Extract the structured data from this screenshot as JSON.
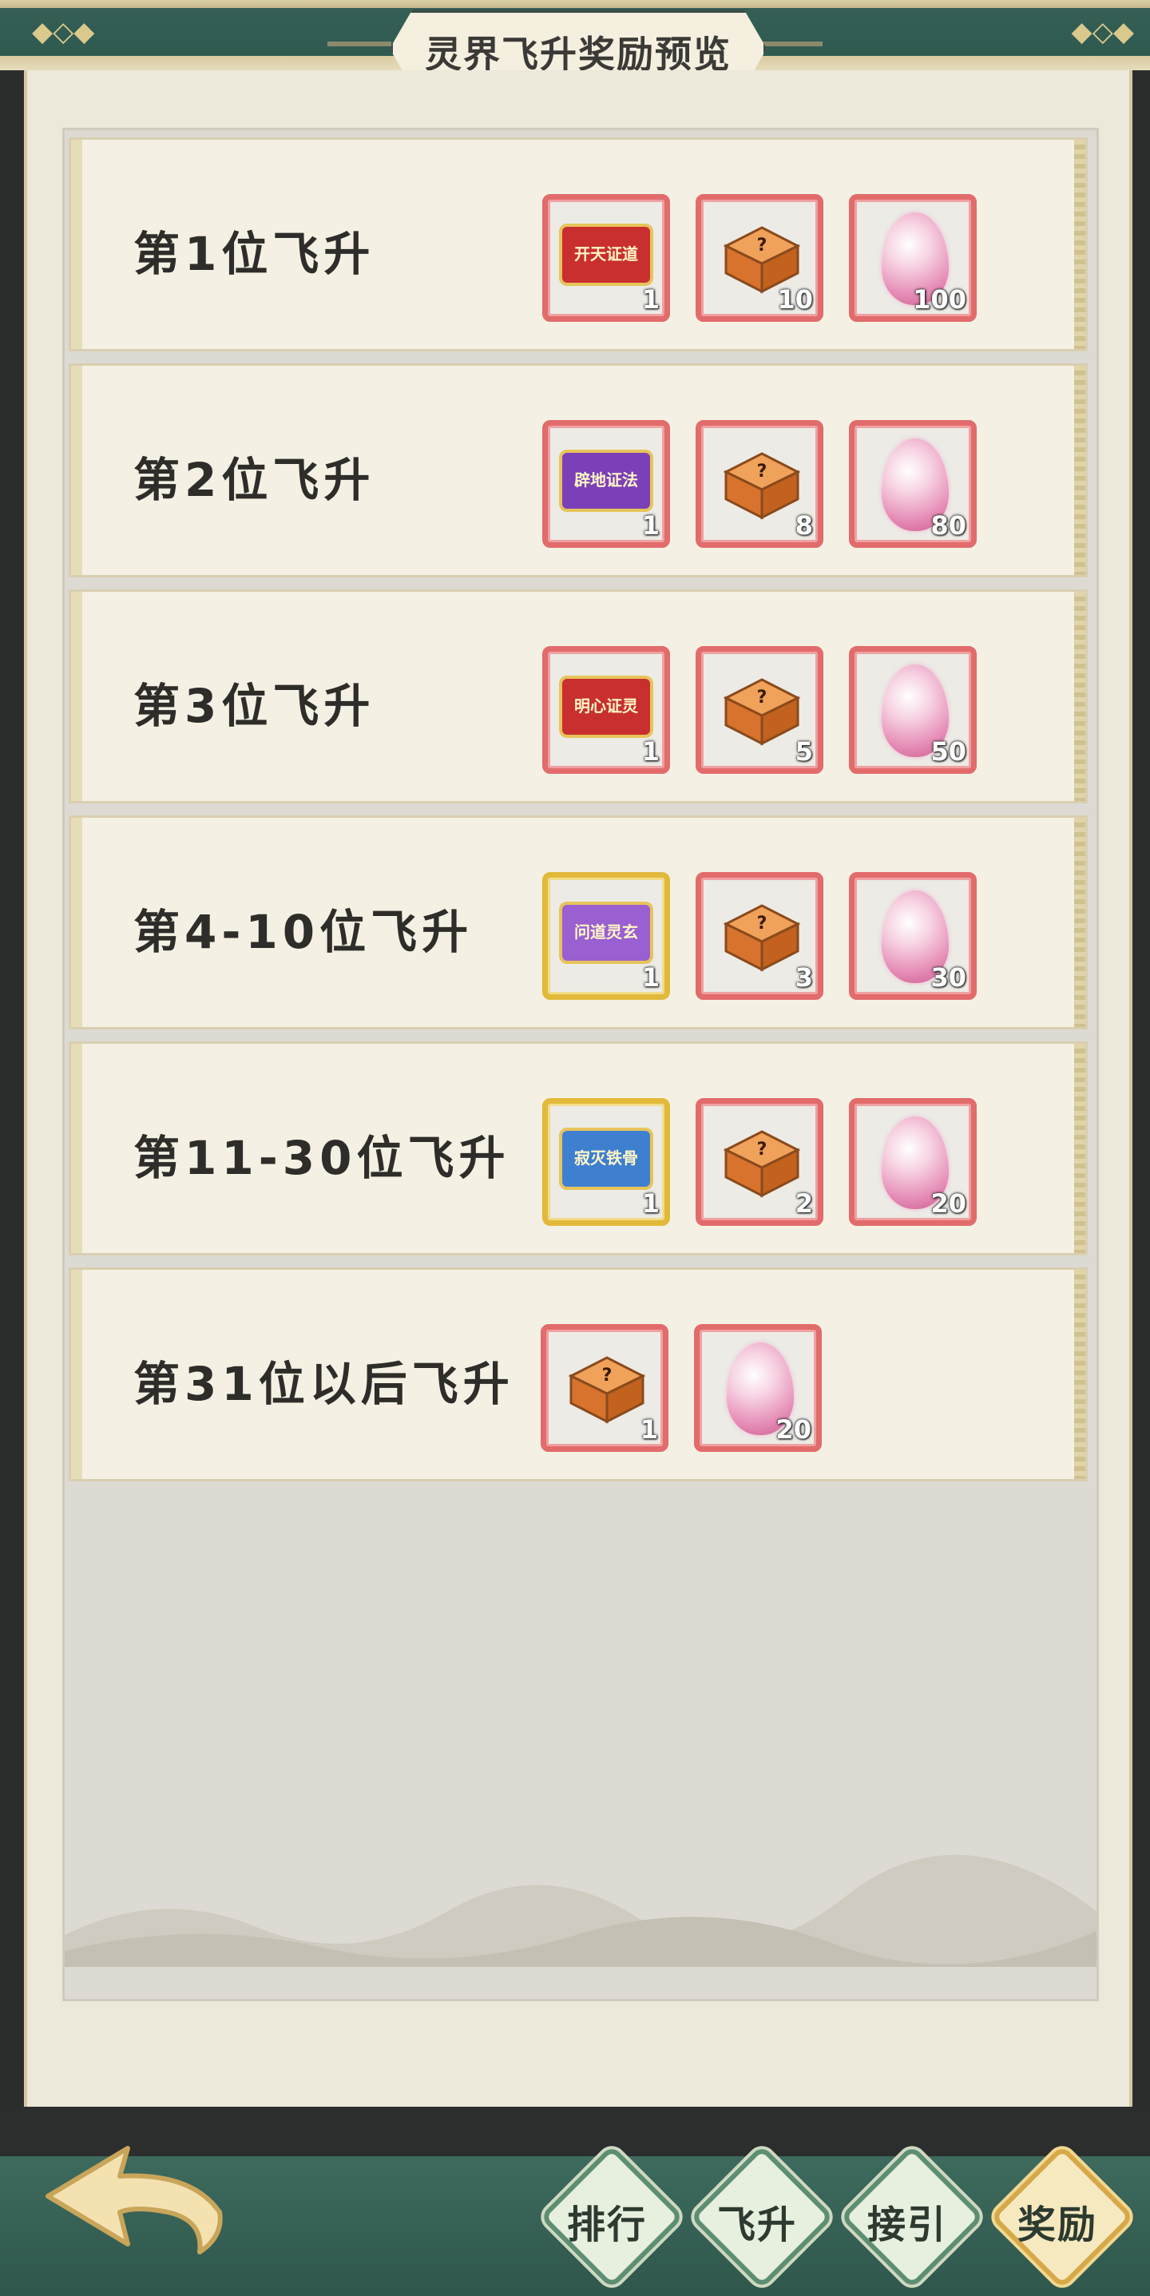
{
  "header": {
    "title": "灵界飞升奖励预览"
  },
  "rows": [
    {
      "label": "第1位飞升",
      "items": [
        {
          "kind": "scroll",
          "text": "开天证道",
          "color": "#c92f2f",
          "frame": "red",
          "qty": "1"
        },
        {
          "kind": "box",
          "frame": "red",
          "qty": "10"
        },
        {
          "kind": "egg",
          "frame": "red",
          "qty": "100"
        }
      ]
    },
    {
      "label": "第2位飞升",
      "items": [
        {
          "kind": "scroll",
          "text": "辟地证法",
          "color": "#7b3fb8",
          "frame": "red",
          "qty": "1"
        },
        {
          "kind": "box",
          "frame": "red",
          "qty": "8"
        },
        {
          "kind": "egg",
          "frame": "red",
          "qty": "80"
        }
      ]
    },
    {
      "label": "第3位飞升",
      "items": [
        {
          "kind": "scroll",
          "text": "明心证灵",
          "color": "#c92f2f",
          "frame": "red",
          "qty": "1"
        },
        {
          "kind": "box",
          "frame": "red",
          "qty": "5"
        },
        {
          "kind": "egg",
          "frame": "red",
          "qty": "50"
        }
      ]
    },
    {
      "label": "第4-10位飞升",
      "items": [
        {
          "kind": "scroll",
          "text": "问道灵玄",
          "color": "#9a5fd0",
          "frame": "gold",
          "qty": "1"
        },
        {
          "kind": "box",
          "frame": "red",
          "qty": "3"
        },
        {
          "kind": "egg",
          "frame": "red",
          "qty": "30"
        }
      ]
    },
    {
      "label": "第11-30位飞升",
      "items": [
        {
          "kind": "scroll",
          "text": "寂灭铁骨",
          "color": "#3f7fd0",
          "frame": "gold",
          "qty": "1"
        },
        {
          "kind": "box",
          "frame": "red",
          "qty": "2"
        },
        {
          "kind": "egg",
          "frame": "red",
          "qty": "20"
        }
      ]
    },
    {
      "label": "第31位以后飞升",
      "items": [
        {
          "kind": "box",
          "frame": "red",
          "qty": "1"
        },
        {
          "kind": "egg",
          "frame": "red",
          "qty": "20"
        }
      ]
    }
  ],
  "bottom_nav": {
    "back_icon": "back-arrow-icon",
    "tabs": [
      {
        "label": "排行",
        "active": false
      },
      {
        "label": "飞升",
        "active": false
      },
      {
        "label": "接引",
        "active": false
      },
      {
        "label": "奖励",
        "active": true
      }
    ]
  },
  "colors": {
    "panel": "#ece8da",
    "frame_red": "#e26b6b",
    "frame_gold": "#e2b93a",
    "nav_green": "#3e6a5e",
    "accent_gold": "#d6a848"
  }
}
